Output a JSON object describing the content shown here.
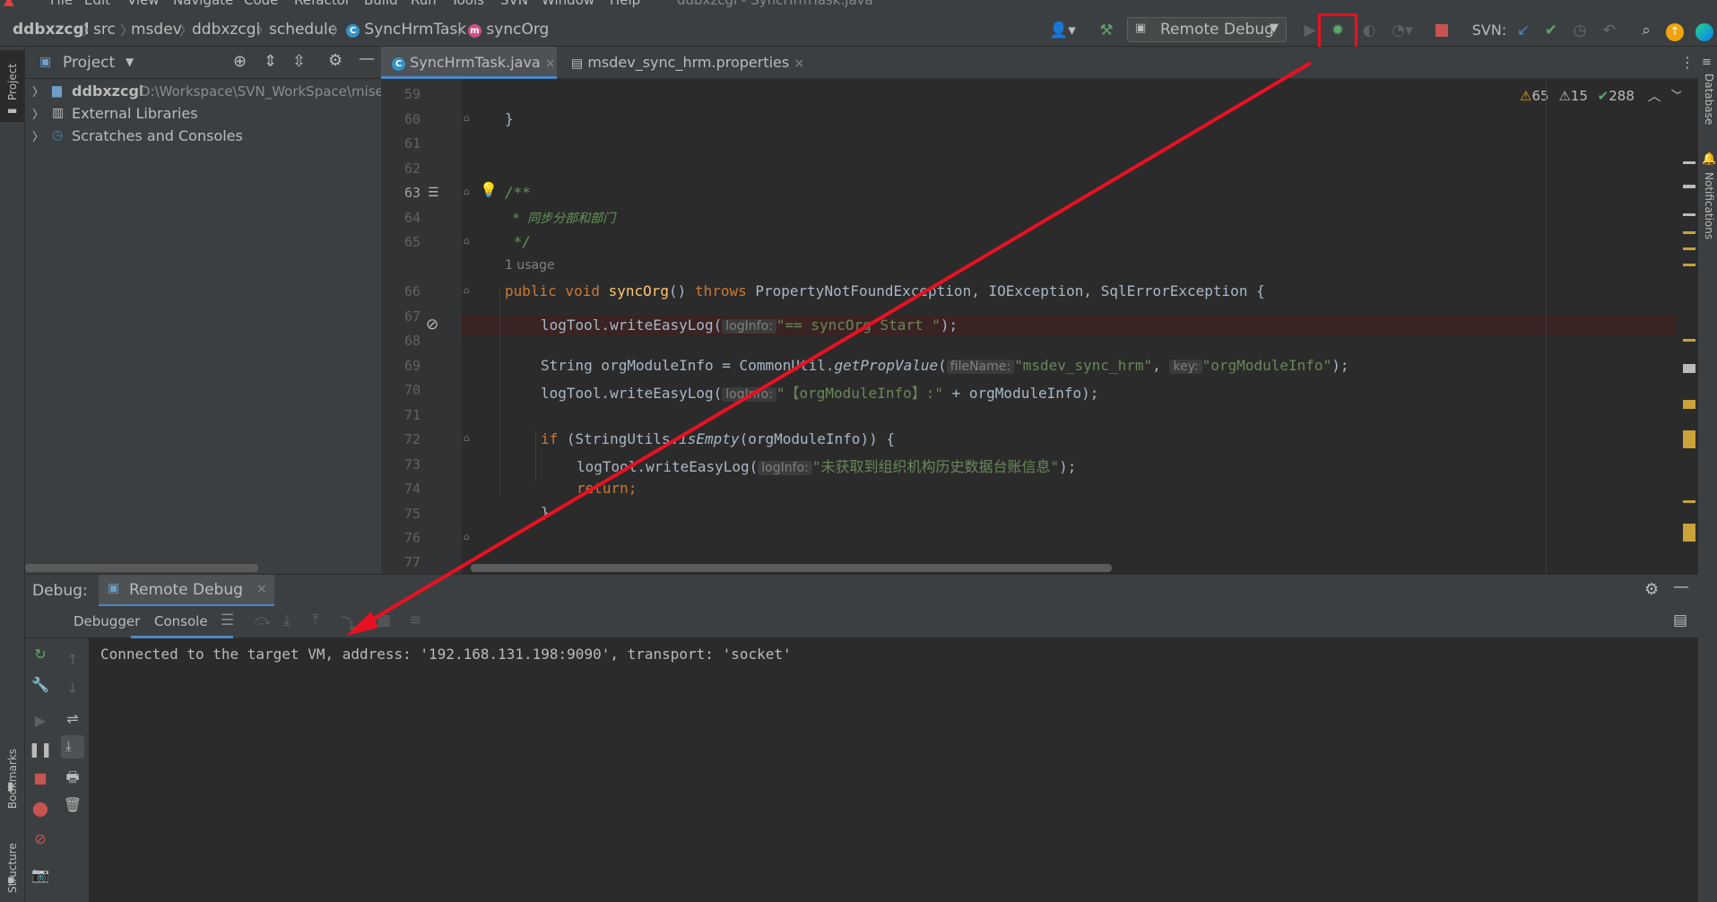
{
  "menu": [
    "File",
    "Edit",
    "View",
    "Navigate",
    "Code",
    "Refactor",
    "Build",
    "Run",
    "Tools",
    "SVN",
    "Window",
    "Help"
  ],
  "window_title": "ddbxzcgl - SyncHrmTask.java",
  "breadcrumb": [
    "ddbxzcgl",
    "src",
    "msdev",
    "ddbxzcgl",
    "schedule",
    "SyncHrmTask",
    "syncOrg"
  ],
  "toolbar": {
    "run_config": "Remote Debug",
    "svn_label": "SVN:"
  },
  "colors": {
    "highlight": "#e81123",
    "accent": "#4a88c7",
    "bug": "#59a869"
  },
  "left_strip": {
    "project": "Project",
    "bookmarks": "Bookmarks",
    "structure": "Structure"
  },
  "right_strip": {
    "database": "Database",
    "notifications": "Notifications"
  },
  "project_panel": {
    "title": "Project",
    "tree": [
      {
        "name": "ddbxzcgl",
        "path": "D:\\Workspace\\SVN_WorkSpace\\mise"
      },
      {
        "name": "External Libraries"
      },
      {
        "name": "Scratches and Consoles"
      }
    ]
  },
  "editor": {
    "tabs": [
      {
        "label": "SyncHrmTask.java"
      },
      {
        "label": "msdev_sync_hrm.properties"
      }
    ],
    "inspections": {
      "warnings": "65",
      "weak": "15",
      "ok": "288"
    },
    "usage_hint": "1 usage",
    "line_numbers": [
      "59",
      "60",
      "61",
      "62",
      "63",
      "64",
      "65",
      "66",
      "67",
      "68",
      "69",
      "70",
      "71",
      "72",
      "73",
      "74",
      "75",
      "76",
      "77"
    ],
    "lines": {
      "l60": "}",
      "l63": "/**",
      "l64": " * 同步分部和部门",
      "l65": " */",
      "l66_kw1": "public void ",
      "l66_fn": "syncOrg",
      "l66_rest1": "() ",
      "l66_kw2": "throws ",
      "l66_rest2": "PropertyNotFoundException, IOException, SqlErrorException {",
      "l68_a": "logTool.writeEasyLog(",
      "l68_hint": "logInfo:",
      "l68_str": "\"== syncOrg Start \"",
      "l68_end": ");",
      "l70_a": "String orgModuleInfo = CommonUtil.",
      "l70_fn": "getPropValue",
      "l70_b": "(",
      "l70_h1": "fileName:",
      "l70_s1": "\"msdev_sync_hrm\"",
      "l70_c": ", ",
      "l70_h2": "key:",
      "l70_s2": "\"orgModuleInfo\"",
      "l70_end": ");",
      "l71_a": "logTool.writeEasyLog(",
      "l71_hint": "logInfo:",
      "l71_str": "\"【orgModuleInfo】:\"",
      "l71_end": " + orgModuleInfo);",
      "l73_kw": "if ",
      "l73_a": "(StringUtils.",
      "l73_fn": "isEmpty",
      "l73_b": "(orgModuleInfo)) {",
      "l74_a": "logTool.writeEasyLog(",
      "l74_hint": "logInfo:",
      "l74_str": "\"未获取到组织机构历史数据台账信息\"",
      "l74_end": ");",
      "l75": "return;",
      "l76": "}"
    }
  },
  "debug_panel": {
    "label": "Debug:",
    "session_tab": "Remote Debug",
    "tabs": [
      "Debugger",
      "Console"
    ],
    "console_output": "Connected to the target VM, address: '192.168.131.198:9090', transport: 'socket'"
  }
}
